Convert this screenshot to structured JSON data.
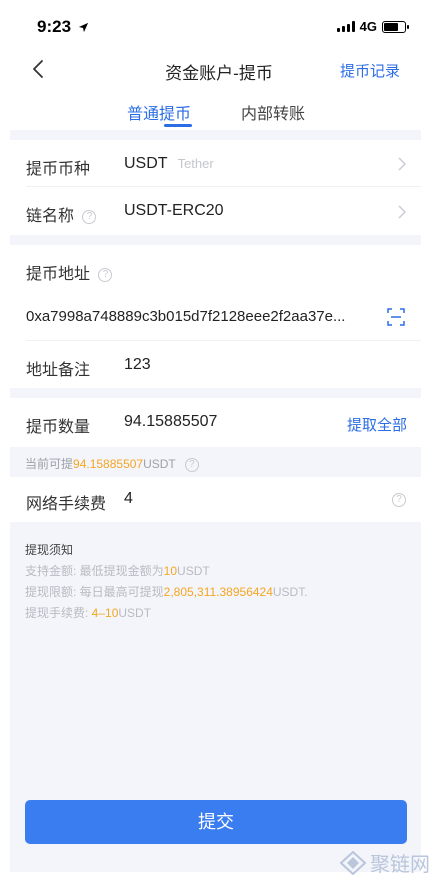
{
  "status": {
    "time": "9:23",
    "network": "4G",
    "battery_level": 0.7
  },
  "nav": {
    "title": "资金账户-提币",
    "action": "提币记录"
  },
  "tabs": [
    {
      "label": "普通提币",
      "active": true
    },
    {
      "label": "内部转账",
      "active": false
    }
  ],
  "form": {
    "coin_label": "提币币种",
    "coin_value": "USDT",
    "coin_hint": "Tether",
    "chain_label": "链名称",
    "chain_value": "USDT-ERC20",
    "address_label": "提币地址",
    "address_value": "0xa7998a748889c3b015d7f2128eee2f2aa37e...",
    "memo_label": "地址备注",
    "memo_value": "123",
    "amount_label": "提币数量",
    "amount_value": "94.15885507",
    "withdraw_all": "提取全部",
    "available_prefix": "当前可提",
    "available_amount": "94.15885507",
    "available_unit": "USDT",
    "fee_label": "网络手续费",
    "fee_value": "4"
  },
  "notes": {
    "title": "提现须知",
    "min_prefix": "支持金额: 最低提现金额为",
    "min_value": "10",
    "min_unit": "USDT",
    "limit_prefix": "提现限额: 每日最高可提现",
    "limit_value": "2,805,311.38956424",
    "limit_unit": "USDT.",
    "fee_prefix": "提现手续费: ",
    "fee_range": "4–10",
    "fee_unit": "USDT"
  },
  "submit_label": "提交",
  "watermark": "聚链网",
  "colors": {
    "accent": "#2b6de5",
    "button": "#3a7df0",
    "highlight": "#f5a623"
  }
}
